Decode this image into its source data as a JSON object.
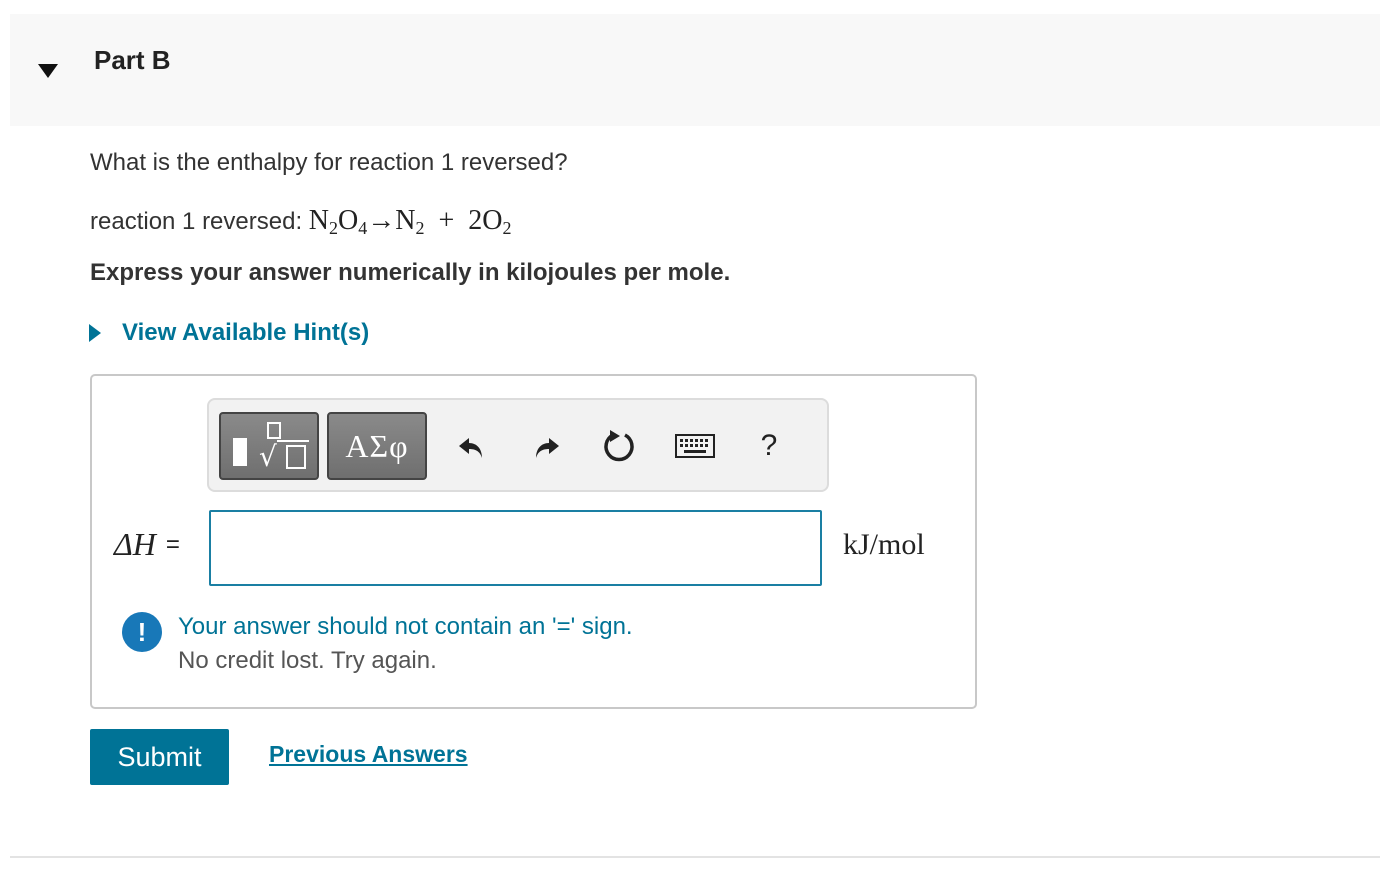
{
  "part": {
    "title": "Part B",
    "collapse_icon": "triangle-down-icon"
  },
  "question": {
    "text": "What is the enthalpy for reaction 1 reversed?",
    "reaction_label": "reaction 1 reversed: ",
    "reaction": {
      "r1": "N",
      "r1_sub": "2",
      "r2": "O",
      "r2_sub": "4",
      "arrow": "→",
      "p1": "N",
      "p1_sub": "2",
      "plus": "+",
      "p2": "2O",
      "p2_sub": "2"
    },
    "instruction": "Express your answer numerically in kilojoules per mole."
  },
  "hints": {
    "label": "View Available Hint(s)",
    "icon": "triangle-right-icon"
  },
  "toolbar": {
    "templates_icon": "templates-icon",
    "symbols_label": "ΑΣφ",
    "undo_icon": "undo-icon",
    "redo_icon": "redo-icon",
    "reset_icon": "reset-icon",
    "keyboard_icon": "keyboard-icon",
    "help_label": "?"
  },
  "answer": {
    "label": "ΔH",
    "equals": "=",
    "value": "",
    "units": "kJ/mol"
  },
  "feedback": {
    "icon": "!",
    "message": "Your answer should not contain an '=' sign.",
    "sub": "No credit lost. Try again."
  },
  "actions": {
    "submit_label": "Submit",
    "previous_answers_label": "Previous Answers"
  },
  "colors": {
    "accent": "#007396",
    "info": "#1878b8",
    "header_bg": "#f8f8f8"
  }
}
